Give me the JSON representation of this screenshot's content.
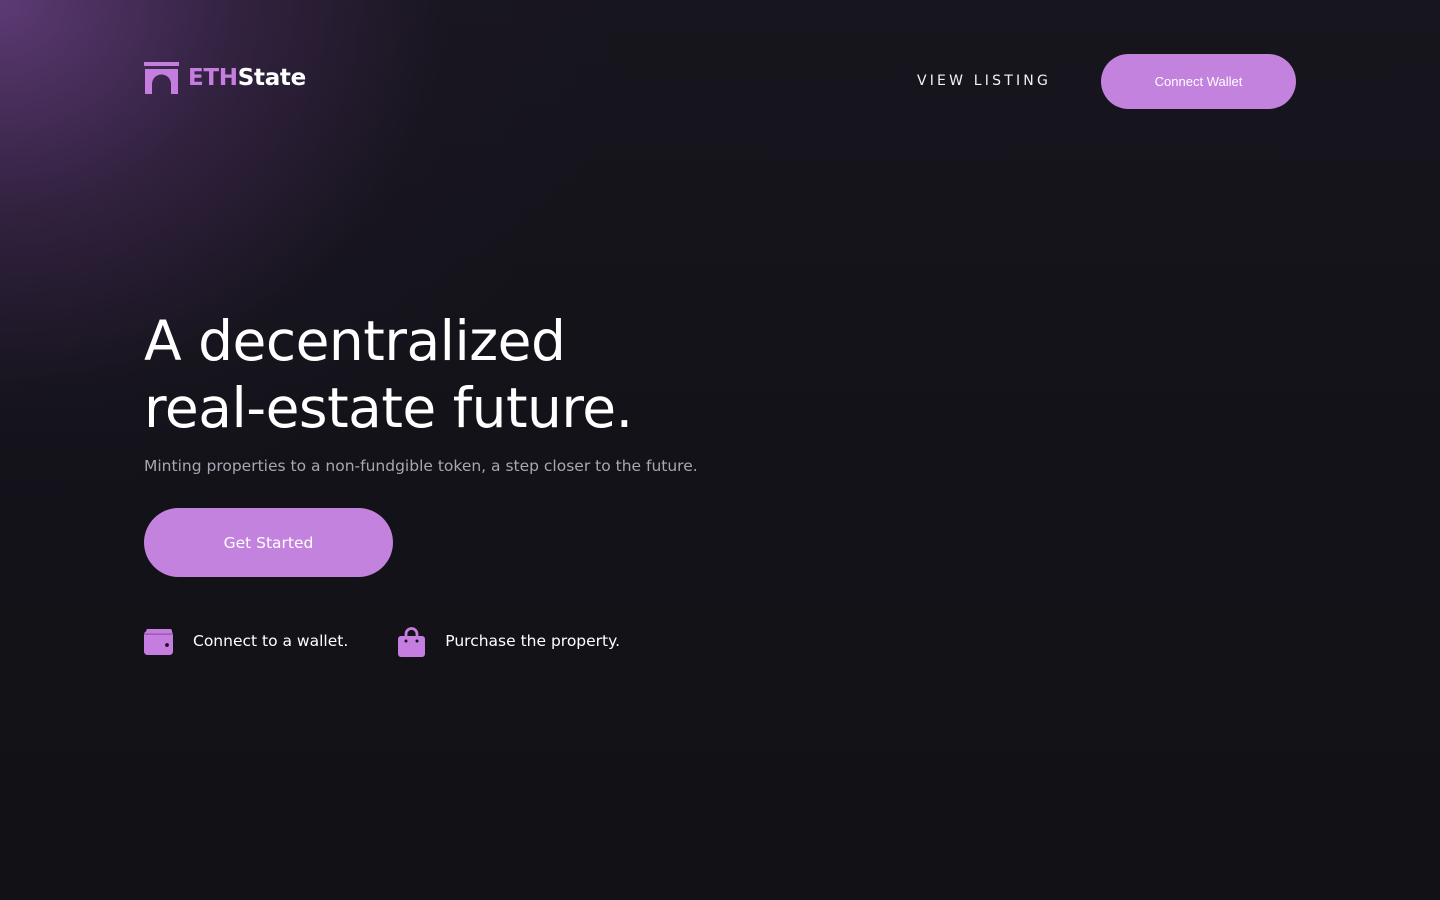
{
  "brand": {
    "name_part1": "ETH",
    "name_part2": "State",
    "icon": "building-arch-icon",
    "accent_color": "#c382de"
  },
  "nav": {
    "view_listing": "VIEW LISTING",
    "connect_wallet": "Connect Wallet"
  },
  "hero": {
    "title_line1": "A decentralized",
    "title_line2": "real-estate future.",
    "subtitle": "Minting properties to a non-fundgible token, a step closer to the future.",
    "cta": "Get Started"
  },
  "features": [
    {
      "icon": "wallet-icon",
      "label": "Connect to a wallet."
    },
    {
      "icon": "shopping-bag-icon",
      "label": "Purchase the property."
    }
  ],
  "colors": {
    "background": "#121218",
    "accent": "#c382de",
    "muted_text": "#a9a6b3"
  }
}
